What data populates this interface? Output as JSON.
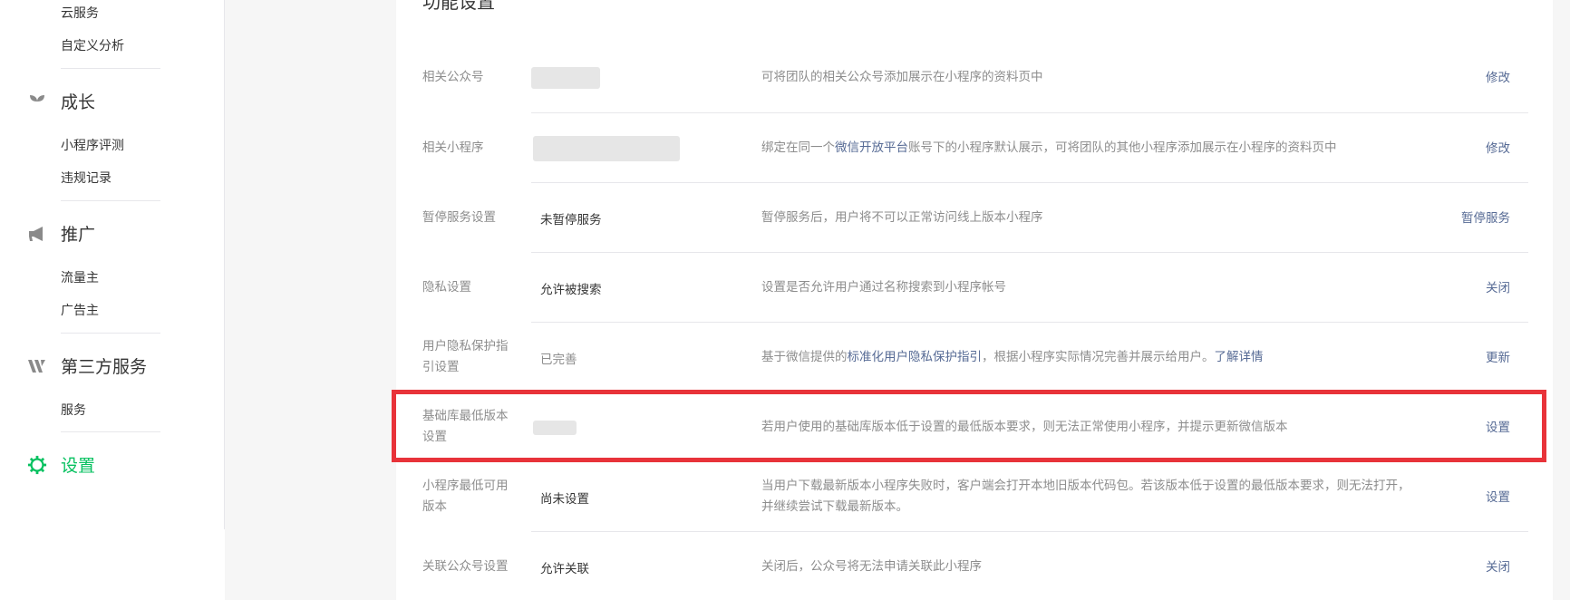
{
  "sidebar": {
    "top_items": [
      "云服务",
      "自定义分析"
    ],
    "growth": {
      "label": "成长",
      "icon": "sprout-icon",
      "items": [
        "小程序评测",
        "违规记录"
      ]
    },
    "promote": {
      "label": "推广",
      "icon": "megaphone-icon",
      "items": [
        "流量主",
        "广告主"
      ]
    },
    "third_party": {
      "label": "第三方服务",
      "icon": "third-party-icon",
      "items": [
        "服务"
      ]
    },
    "settings": {
      "label": "设置",
      "icon": "gear-icon",
      "active": true,
      "accent_color": "#07c160"
    }
  },
  "main": {
    "section_title": "功能设置",
    "rows": [
      {
        "label": "相关公众号",
        "value": "",
        "desc": "可将团队的相关公众号添加展示在小程序的资料页中",
        "action": "修改"
      },
      {
        "label": "相关小程序",
        "value": "",
        "desc_before": "绑定在同一个",
        "desc_link": "微信开放平台",
        "desc_after": "账号下的小程序默认展示，可将团队的其他小程序添加展示在小程序的资料页中",
        "action": "修改"
      },
      {
        "label": "暂停服务设置",
        "value": "未暂停服务",
        "desc": "暂停服务后，用户将不可以正常访问线上版本小程序",
        "action": "暂停服务"
      },
      {
        "label": "隐私设置",
        "value": "允许被搜索",
        "desc": "设置是否允许用户通过名称搜索到小程序帐号",
        "action": "关闭"
      },
      {
        "label": "用户隐私保护指引设置",
        "value": "已完善",
        "desc_before": "基于微信提供的",
        "desc_link": "标准化用户隐私保护指引",
        "desc_after": "，根据小程序实际情况完善并展示给用户。",
        "desc_link2": "了解详情",
        "action": "更新"
      },
      {
        "label": "基础库最低版本设置",
        "value": "",
        "desc": "若用户使用的基础库版本低于设置的最低版本要求，则无法正常使用小程序，并提示更新微信版本",
        "action": "设置"
      },
      {
        "label": "小程序最低可用版本",
        "value": "尚未设置",
        "desc": "当用户下载最新版本小程序失败时，客户端会打开本地旧版本代码包。若该版本低于设置的最低版本要求，则无法打开，并继续尝试下载最新版本。",
        "action": "设置"
      },
      {
        "label": "关联公众号设置",
        "value": "允许关联",
        "desc": "关闭后，公众号将无法申请关联此小程序",
        "action": "关闭"
      }
    ]
  },
  "colors": {
    "link": "#576b95",
    "accent": "#07c160",
    "highlight_border": "#e8333a"
  }
}
